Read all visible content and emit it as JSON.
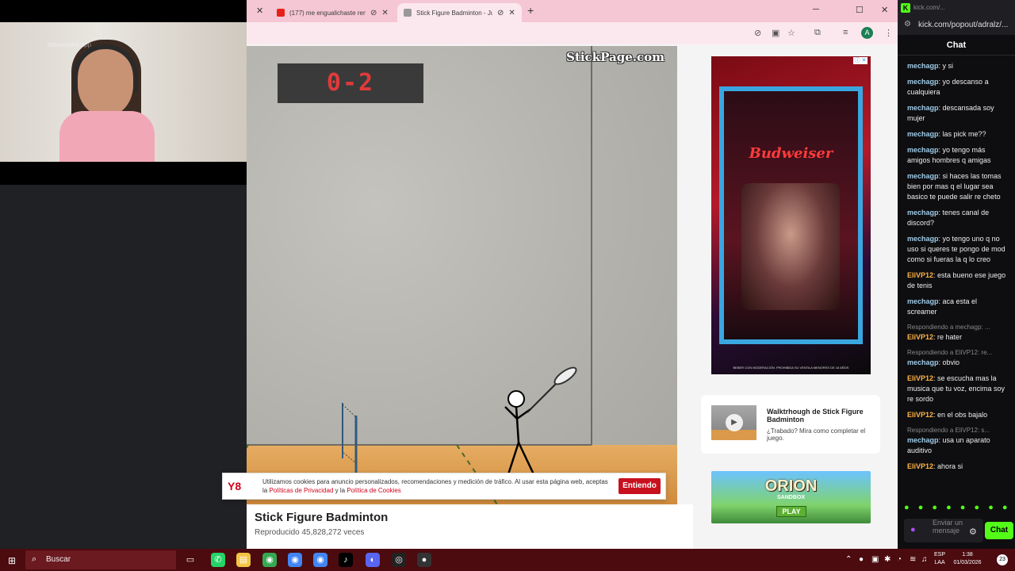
{
  "tabs": [
    {
      "title": "(177) me engualichaste rem",
      "active": false
    },
    {
      "title": "Stick Figure Badminton - Ju",
      "active": true
    }
  ],
  "game": {
    "score": "0-2",
    "logo": "StickPage.com",
    "title": "Stick Figure Badminton",
    "plays": "Reproducido 45,828,272 veces"
  },
  "cookie": {
    "logo": "Y8",
    "text_before": "Utilizamos cookies para anuncio personalizados, recomendaciones y medición de tráfico. Al usar esta página web, aceptas la",
    "privacy_link": "Políticas de Privacidad",
    "and": "y la",
    "cookies_link": "Política de Cookies",
    "accept": "Entiendo"
  },
  "sidebar": {
    "ad1_brand": "Budweiser",
    "ad1_fine": "BEBER CON MODERACIÓN. PROHIBIDA SU VENTA A MENORES DE 18 AÑOS",
    "walkthrough_title": "Walktrhough de Stick Figure Badminton",
    "walkthrough_sub": "¿Trabado? Mira como completar el juego.",
    "ad2_title": "ORION",
    "ad2_sub": "SANDBOX",
    "ad2_play": "PLAY"
  },
  "cam": {
    "watermark": "streamcam.app"
  },
  "chat": {
    "url": "kick.com/popout/adralz/...",
    "titlebar_url": "kick.com/...",
    "header": "Chat",
    "messages": [
      {
        "user": "mechagp",
        "text": "y si",
        "style": "m"
      },
      {
        "user": "mechagp",
        "text": "yo descanso a cualquiera",
        "style": "m"
      },
      {
        "user": "mechagp",
        "text": "descansada soy mujer",
        "style": "m"
      },
      {
        "user": "mechagp",
        "text": "las pick me??",
        "style": "m"
      },
      {
        "user": "mechagp",
        "text": "yo tengo más amigos hombres q amigas",
        "style": "m"
      },
      {
        "user": "mechagp",
        "text": "si haces las tomas bien por mas q el lugar sea basico te puede salir re cheto",
        "style": "m"
      },
      {
        "user": "mechagp",
        "text": "tenes canal de discord?",
        "style": "m"
      },
      {
        "user": "mechagp",
        "text": "yo tengo uno q no uso si queres te pongo de mod como si fueras la q lo creo",
        "style": "m"
      },
      {
        "user": "EliVP12",
        "text": "esta bueno ese juego de tenis",
        "style": "e"
      },
      {
        "user": "mechagp",
        "text": "aca esta el screamer",
        "style": "m"
      },
      {
        "reply": "Respondiendo a mechagp: ...",
        "user": "EliVP12",
        "text": "re hater",
        "style": "e"
      },
      {
        "reply": "Respondiendo a EliVP12: re...",
        "user": "mechagp",
        "text": "obvio",
        "style": "m"
      },
      {
        "user": "EliVP12",
        "text": "se escucha mas la musica que tu voz, encima soy re sordo",
        "style": "e"
      },
      {
        "user": "EliVP12",
        "text": "en el obs bajalo",
        "style": "e"
      },
      {
        "reply": "Respondiendo a EliVP12: s...",
        "user": "mechagp",
        "text": "usa un aparato auditivo",
        "style": "m"
      },
      {
        "user": "EliVP12",
        "text": "ahora si",
        "style": "e"
      }
    ],
    "input_placeholder": "Enviar un mensaje",
    "send": "Chat"
  },
  "taskbar": {
    "search": "Buscar",
    "lang1": "ESP",
    "lang2": "LAA",
    "time": "1:38",
    "date": "01/03/2026",
    "notifications": "23"
  },
  "colors": {
    "accent_kick": "#53fc18",
    "score_red": "#e23a3a",
    "cookie_red": "#c8101e"
  }
}
